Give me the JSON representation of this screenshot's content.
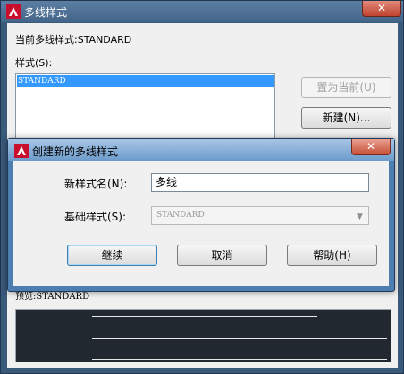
{
  "main_dialog": {
    "title": "多线样式",
    "close_label": "✕",
    "current_style": "当前多线样式:STANDARD",
    "styles_label": "样式(S):",
    "styles_list": [
      "STANDARD"
    ],
    "set_current_button": "置为当前(U)",
    "new_button": "新建(N)...",
    "preview_label": "预览:STANDARD"
  },
  "create_dialog": {
    "title": "创建新的多线样式",
    "close_label": "✕",
    "new_name_label": "新样式名(N):",
    "new_name_value": "多线",
    "base_style_label": "基础样式(S):",
    "base_style_value": "STANDARD",
    "continue_button": "继续",
    "cancel_button": "取消",
    "help_button": "帮助(H)"
  },
  "icons": {
    "app": "autocad-logo-icon",
    "dropdown": "chevron-down-icon"
  },
  "colors": {
    "selection": "#3399ff",
    "preview_background": "#212830",
    "close_button": "#c0432f"
  }
}
